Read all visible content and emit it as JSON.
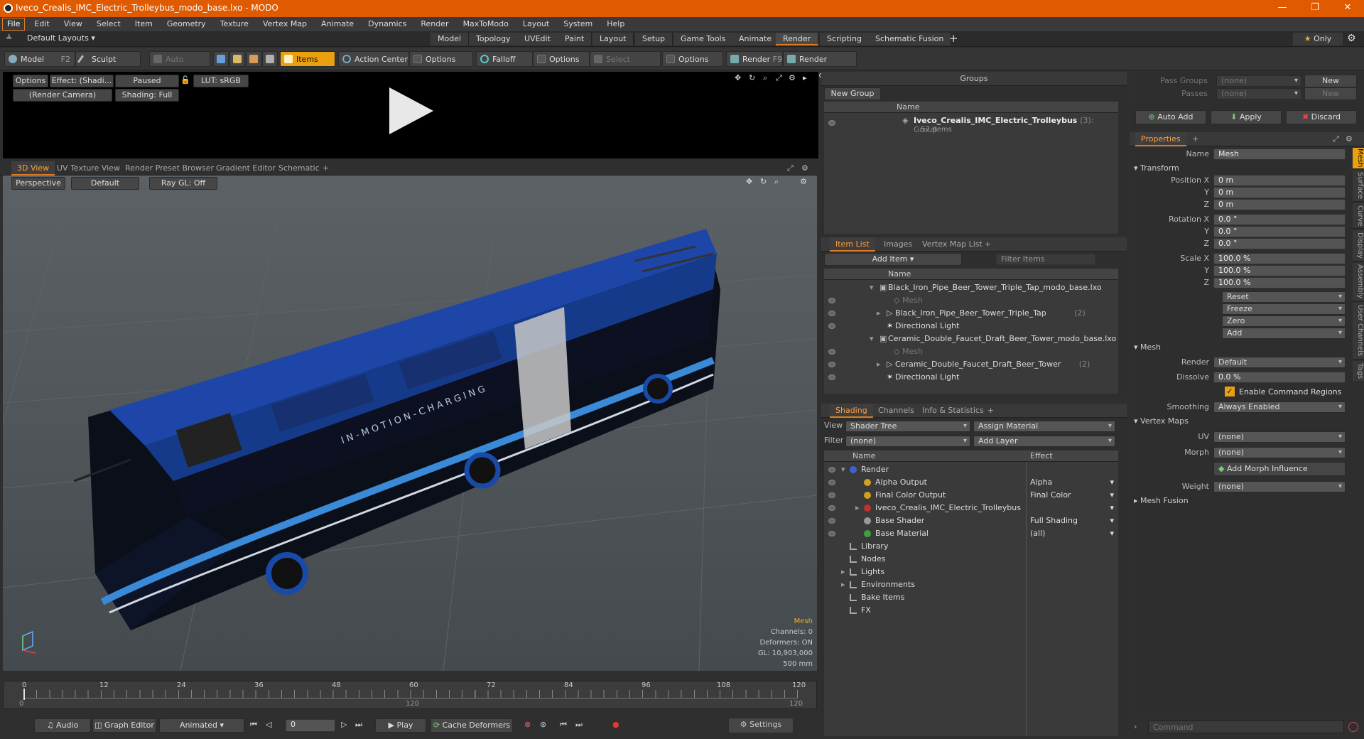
{
  "window": {
    "title": "Iveco_Crealis_IMC_Electric_Trolleybus_modo_base.lxo - MODO"
  },
  "menu": [
    "File",
    "Edit",
    "View",
    "Select",
    "Item",
    "Geometry",
    "Texture",
    "Vertex Map",
    "Animate",
    "Dynamics",
    "Render",
    "MaxToModo",
    "Layout",
    "System",
    "Help"
  ],
  "layouts": {
    "selector": "Default Layouts",
    "tabs": [
      "Model",
      "Topology",
      "UVEdit",
      "Paint",
      "Layout",
      "Setup",
      "Game Tools",
      "Animate",
      "Render",
      "Scripting",
      "Schematic Fusion"
    ],
    "active": "Render",
    "only": "Only"
  },
  "toolbar": {
    "model": "Model",
    "model_key": "F2",
    "sculpt": "Sculpt",
    "auto_select": "Auto Select",
    "items": "Items",
    "action_center": "Action Center",
    "options1": "Options",
    "falloff": "Falloff",
    "options2": "Options",
    "select_through": "Select Through",
    "options3": "Options",
    "render": "Render",
    "render_key": "F9",
    "render_window": "Render Window"
  },
  "preview": {
    "options": "Options",
    "effect": "Effect: (Shadi...",
    "paused": "Paused",
    "lut": "LUT: sRGB",
    "camera": "(Render Camera)",
    "shading": "Shading: Full"
  },
  "viewport": {
    "tabs": [
      "3D View",
      "UV Texture View",
      "Render Preset Browser",
      "Gradient Editor",
      "Schematic"
    ],
    "perspective": "Perspective",
    "default": "Default",
    "raygl": "Ray GL: Off",
    "livery_text": "IN-MOTION-CHARGING",
    "stats": {
      "title": "Mesh",
      "channels": "Channels: 0",
      "deformers": "Deformers: ON",
      "gl": "GL: 10,903,000",
      "scale": "500 mm"
    }
  },
  "timeline": {
    "ticks": [
      "0",
      "12",
      "24",
      "36",
      "48",
      "60",
      "72",
      "84",
      "96",
      "108",
      "120"
    ],
    "sub_left": "0",
    "sub_mid": "120",
    "sub_right": "120"
  },
  "bottombar": {
    "audio": "Audio",
    "graph_editor": "Graph Editor",
    "animated": "Animated",
    "frame": "0",
    "play": "Play",
    "cache": "Cache Deformers",
    "settings": "Settings"
  },
  "groups": {
    "title": "Groups",
    "new_group": "New Group",
    "col_name": "Name",
    "item_name": "Iveco_Crealis_IMC_Electric_Trolleybus",
    "item_count": "(3)",
    "item_type": ": Group",
    "item_sub": "57 Items"
  },
  "itemlist": {
    "tabs": [
      "Item List",
      "Images",
      "Vertex Map List"
    ],
    "add_item": "Add Item",
    "filter": "Filter Items",
    "col_name": "Name",
    "rows": [
      {
        "label": "Black_Iron_Pipe_Beer_Tower_Triple_Tap_modo_base.lxo",
        "indent": 0,
        "kind": "scene"
      },
      {
        "label": "Mesh",
        "indent": 2,
        "kind": "mesh"
      },
      {
        "label": "Black_Iron_Pipe_Beer_Tower_Triple_Tap",
        "extra": "(2)",
        "indent": 1,
        "kind": "group"
      },
      {
        "label": "Directional Light",
        "indent": 1,
        "kind": "light"
      },
      {
        "label": "Ceramic_Double_Faucet_Draft_Beer_Tower_modo_base.lxo",
        "indent": 0,
        "kind": "scene"
      },
      {
        "label": "Mesh",
        "indent": 2,
        "kind": "mesh"
      },
      {
        "label": "Ceramic_Double_Faucet_Draft_Beer_Tower",
        "extra": "(2)",
        "indent": 1,
        "kind": "group"
      },
      {
        "label": "Directional Light",
        "indent": 1,
        "kind": "light"
      }
    ]
  },
  "shading": {
    "tabs": [
      "Shading",
      "Channels",
      "Info & Statistics"
    ],
    "view_label": "View",
    "view_value": "Shader Tree",
    "assign": "Assign Material",
    "filter_label": "Filter",
    "filter_value": "(none)",
    "add_layer": "Add Layer",
    "col_name": "Name",
    "col_effect": "Effect",
    "rows": [
      {
        "name": "Render",
        "effect": "",
        "indent": 0,
        "color": "#4060d0"
      },
      {
        "name": "Alpha Output",
        "effect": "Alpha",
        "indent": 1,
        "color": "#d0a020"
      },
      {
        "name": "Final Color Output",
        "effect": "Final Color",
        "indent": 1,
        "color": "#d0a020"
      },
      {
        "name": "Iveco_Crealis_IMC_Electric_Trolleybus",
        "effect": "",
        "indent": 1,
        "color": "#c03030"
      },
      {
        "name": "Base Shader",
        "effect": "Full Shading",
        "indent": 1,
        "color": "#999999"
      },
      {
        "name": "Base Material",
        "effect": "(all)",
        "indent": 1,
        "color": "#40a040"
      },
      {
        "name": "Library",
        "effect": "",
        "indent": 0,
        "color": ""
      },
      {
        "name": "Nodes",
        "effect": "",
        "indent": 0,
        "color": ""
      },
      {
        "name": "Lights",
        "effect": "",
        "indent": 0,
        "color": ""
      },
      {
        "name": "Environments",
        "effect": "",
        "indent": 0,
        "color": ""
      },
      {
        "name": "Bake Items",
        "effect": "",
        "indent": 0,
        "color": ""
      },
      {
        "name": "FX",
        "effect": "",
        "indent": 0,
        "color": ""
      }
    ]
  },
  "passes": {
    "pass_groups": "Pass Groups",
    "passes": "Passes",
    "none": "(none)",
    "new": "New",
    "auto_add": "Auto Add",
    "apply": "Apply",
    "discard": "Discard"
  },
  "properties": {
    "tab": "Properties",
    "name_label": "Name",
    "name_value": "Mesh",
    "transform": "Transform",
    "pos_label": "Position X",
    "pos": [
      "0 m",
      "0 m",
      "0 m"
    ],
    "rot_label": "Rotation X",
    "rot": [
      "0.0 °",
      "0.0 °",
      "0.0 °"
    ],
    "scale_label": "Scale X",
    "scale": [
      "100.0 %",
      "100.0 %",
      "100.0 %"
    ],
    "y": "Y",
    "z": "Z",
    "actions": [
      "Reset",
      "Freeze",
      "Zero",
      "Add"
    ],
    "mesh": "Mesh",
    "render_label": "Render",
    "render_value": "Default",
    "dissolve_label": "Dissolve",
    "dissolve_value": "0.0 %",
    "command_regions": "Enable Command Regions",
    "smoothing_label": "Smoothing",
    "smoothing_value": "Always Enabled",
    "vertex_maps": "Vertex Maps",
    "uv_label": "UV",
    "uv_value": "(none)",
    "morph_label": "Morph",
    "morph_value": "(none)",
    "add_morph": "Add Morph Influence",
    "weight_label": "Weight",
    "weight_value": "(none)",
    "mesh_fusion": "Mesh Fusion",
    "side_tabs": [
      "Mesh",
      "Surface",
      "Curve",
      "Display",
      "Assembly",
      "User Channels",
      "Tags"
    ]
  },
  "command": {
    "placeholder": "Command"
  }
}
